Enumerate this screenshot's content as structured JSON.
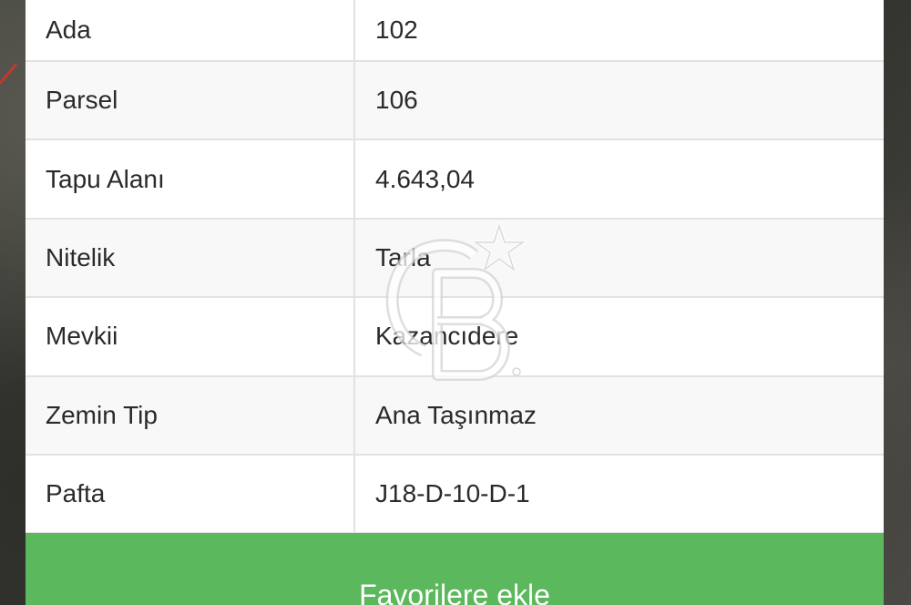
{
  "property_details": {
    "rows": [
      {
        "label": "Ada",
        "value": "102"
      },
      {
        "label": "Parsel",
        "value": "106"
      },
      {
        "label": "Tapu Alanı",
        "value": "4.643,04"
      },
      {
        "label": "Nitelik",
        "value": "Tarla"
      },
      {
        "label": "Mevkii",
        "value": "Kazancıdere"
      },
      {
        "label": "Zemin Tip",
        "value": "Ana Taşınmaz"
      },
      {
        "label": "Pafta",
        "value": "J18-D-10-D-1"
      }
    ]
  },
  "actions": {
    "favorite_label": "Favorilere ekle"
  },
  "colors": {
    "button_green": "#5cb85c",
    "row_alt": "#f8f8f8",
    "divider": "#e2e2e2"
  },
  "icons": {
    "watermark": "coldwell-banker-cb-star-logo"
  }
}
